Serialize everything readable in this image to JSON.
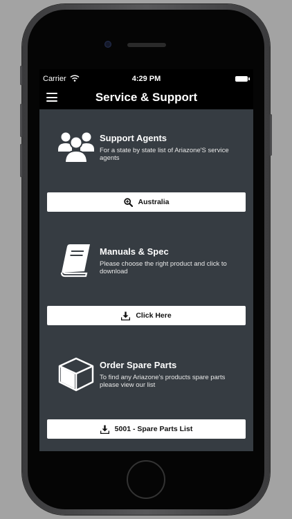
{
  "status_bar": {
    "carrier": "Carrier",
    "time": "4:29 PM"
  },
  "nav": {
    "title": "Service & Support"
  },
  "sections": [
    {
      "title": "Support Agents",
      "description": "For a state by state list of Ariazone'S service agents",
      "icon": "people-icon",
      "button_label": "Australia",
      "button_icon": "zoom-icon"
    },
    {
      "title": "Manuals & Spec",
      "description": "Please choose the right product and click to download",
      "icon": "book-icon",
      "button_label": "Click Here",
      "button_icon": "download-icon"
    },
    {
      "title": "Order Spare Parts",
      "description": "To find any Ariazone's products spare parts please view our list",
      "icon": "box-icon",
      "button_label": "5001 - Spare Parts List",
      "button_icon": "download-icon"
    }
  ],
  "colors": {
    "content_bg": "#363c42",
    "button_bg": "#ffffff",
    "nav_bg": "#000000"
  }
}
